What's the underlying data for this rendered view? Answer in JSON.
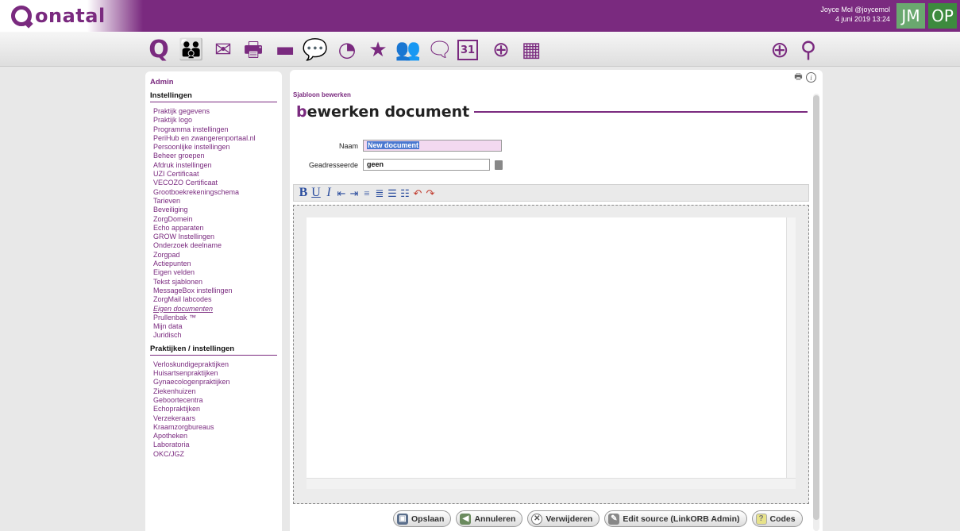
{
  "brand": {
    "name": "onatal",
    "color": "#7a2a7f"
  },
  "user": {
    "name": "Joyce Mol @joycemol",
    "datetime": "4 juni 2019 13:24",
    "initials_1": "JM",
    "initials_2": "OP"
  },
  "toolbar_icons": [
    "logo-q-icon",
    "people-icon",
    "mail-icon",
    "printer-icon",
    "card-icon",
    "chat-bubble-icon",
    "pie-chart-icon",
    "star-icon",
    "group-icon",
    "conversation-icon",
    "calendar-icon",
    "globe-icon",
    "calculator-icon"
  ],
  "toolbar_glyphs": {
    "logo": "Q",
    "people": "👪",
    "mail": "✉",
    "printer": "🖶",
    "card": "▬",
    "chat": "💬",
    "pie": "◔",
    "star": "★",
    "group": "👥",
    "conversation": "🗨",
    "calendar": "31",
    "globe": "⊕",
    "calc": "▦",
    "add": "⊕",
    "search": "⚲"
  },
  "sidebar": {
    "admin": "Admin",
    "section1": "Instellingen",
    "items1": [
      "Praktijk gegevens",
      "Praktijk logo",
      "Programma instellingen",
      "PeriHub en zwangerenportaal.nl",
      "Persoonlijke instellingen",
      "Beheer groepen",
      "Afdruk instellingen",
      "UZI Certificaat",
      "VECOZO Certificaat",
      "Grootboekrekeningschema",
      "Tarieven",
      "Beveiliging",
      "ZorgDomein",
      "Echo apparaten",
      "GROW Instellingen",
      "Onderzoek deelname",
      "Zorgpad",
      "Actiepunten",
      "Eigen velden",
      "Tekst sjablonen",
      "MessageBox instellingen",
      "ZorgMail labcodes",
      "Eigen documenten",
      "Prullenbak ™",
      "Mijn data",
      "Juridisch"
    ],
    "active_item": "Eigen documenten",
    "section2": "Praktijken / instellingen",
    "items2": [
      "Verloskundigepraktijken",
      "Huisartsenpraktijken",
      "Gynaecologenpraktijken",
      "Ziekenhuizen",
      "Geboortecentra",
      "Echopraktijken",
      "Verzekeraars",
      "Kraamzorgbureaus",
      "Apotheken",
      "Laboratoria",
      "OKC/JGZ"
    ]
  },
  "main": {
    "breadcrumb": "Sjabloon bewerken",
    "title_first": "b",
    "title_rest": "ewerken document",
    "naam_label": "Naam",
    "naam_value": "New document",
    "geadresseerde_label": "Geadresseerde",
    "geadresseerde_value": "geen",
    "editor_tools": [
      "B",
      "U",
      "I",
      "⇤",
      "⇥",
      "≡",
      "≣",
      "☰",
      "☷",
      "↶",
      "↷"
    ]
  },
  "buttons": {
    "save": "Opslaan",
    "cancel": "Annuleren",
    "delete": "Verwijderen",
    "edit_source": "Edit source (LinkORB Admin)",
    "codes": "Codes"
  }
}
